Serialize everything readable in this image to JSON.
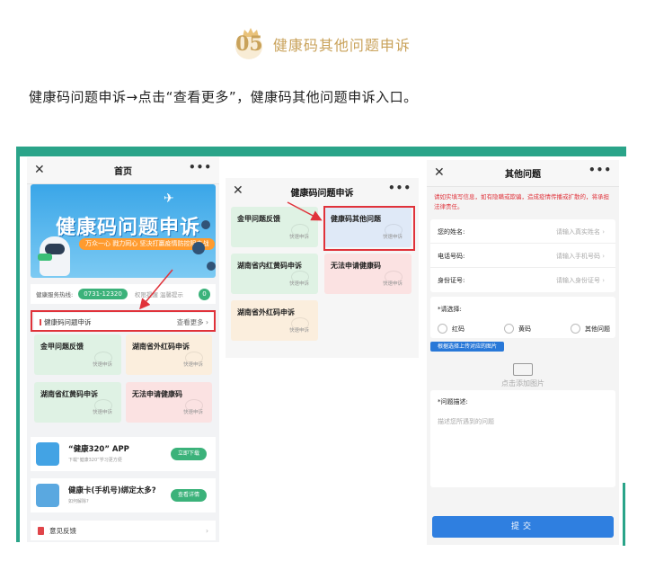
{
  "heading": {
    "number": "05",
    "title": "健康码其他问题申诉"
  },
  "intro": "健康码问题申诉→点击“查看更多”，健康码其他问题申诉入口。",
  "phone1": {
    "title": "首页",
    "banner_title": "健康码问题申诉",
    "banner_sub": "万众一心 戮力同心 坚决打赢疫情防控阻击战",
    "hotline_label": "健康服务热线:",
    "hotline_number": "0731-12320",
    "hotline_muted": "权限提醒 温馨提示",
    "hotline_badge": "0",
    "section_title": "健康码问题申诉",
    "section_more": "查看更多 ›",
    "cards": [
      {
        "label": "金甲问题反馈",
        "tag": "快速申诉"
      },
      {
        "label": "湖南省外红码申诉",
        "tag": "快速申诉"
      },
      {
        "label": "湖南省红黄码申诉",
        "tag": "快速申诉"
      },
      {
        "label": "无法申请健康码",
        "tag": "快速申诉"
      }
    ],
    "app": {
      "title": "“健康320” APP",
      "desc": "下载“健康320”学习更方便",
      "btn": "立即下载"
    },
    "card_bind": {
      "title": "健康卡(手机号)绑定太多?",
      "desc": "如何解除?",
      "btn": "查看详情"
    },
    "feedback": "意见反馈"
  },
  "phone2": {
    "title": "健康码问题申诉",
    "cards": [
      {
        "label": "金甲问题反馈",
        "tag": "快速申诉"
      },
      {
        "label": "健康码其他问题",
        "tag": "快速申诉"
      },
      {
        "label": "湖南省内红黄码申诉",
        "tag": "快速申诉"
      },
      {
        "label": "无法申请健康码",
        "tag": "快速申诉"
      },
      {
        "label": "湖南省外红码申诉",
        "tag": "快速申诉"
      }
    ]
  },
  "phone3": {
    "title": "其他问题",
    "warning": "请如实填写信息，如有隐瞒或欺骗，造成疫情传播或扩散的，将承担法律责任。",
    "fields": [
      {
        "label": "您的姓名:",
        "placeholder": "请输入真实姓名"
      },
      {
        "label": "电话号码:",
        "placeholder": "请输入手机号码"
      },
      {
        "label": "身份证号:",
        "placeholder": "请输入身份证号"
      }
    ],
    "select_label": "*请选择:",
    "options": [
      "红码",
      "黄码",
      "其他问题"
    ],
    "upload_tag": "根据选择上传对应的图片",
    "upload_label": "点击添加图片",
    "desc_label": "*问题描述:",
    "desc_placeholder": "描述您所遇到的问题",
    "submit": "提交"
  },
  "colors": {
    "accent_gold": "#c9a25a",
    "teal": "#2aa489",
    "red_highlight": "#e0323a",
    "submit_blue": "#2f7fe0"
  }
}
